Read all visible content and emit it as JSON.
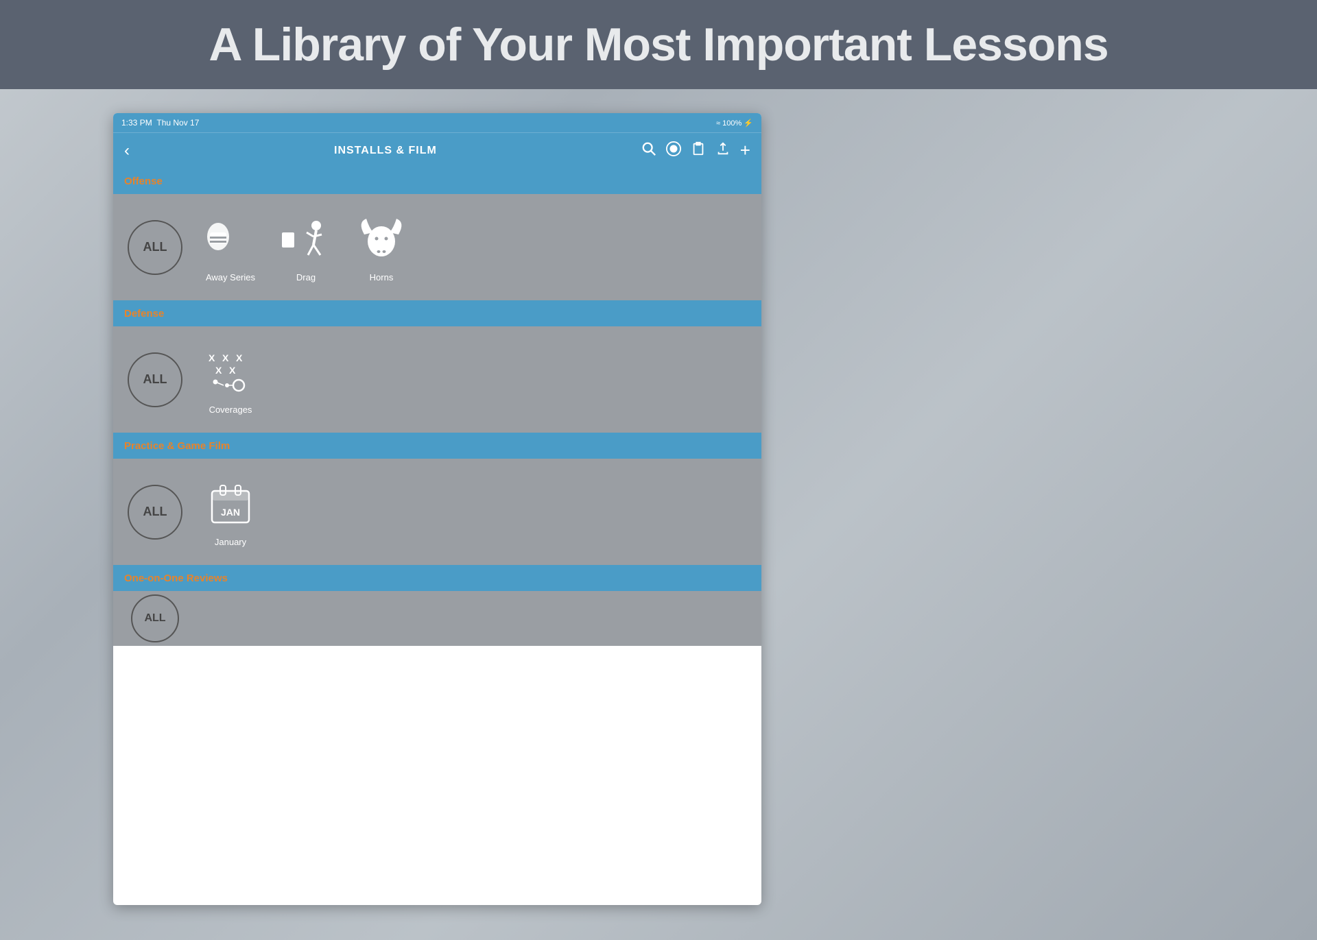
{
  "header": {
    "title": "A Library of Your Most Important Lessons",
    "background_color": "#5a6270"
  },
  "status_bar": {
    "time": "1:33 PM",
    "date": "Thu Nov 17",
    "battery": "100%",
    "signal": "wifi"
  },
  "nav_bar": {
    "back_label": "‹",
    "title": "INSTALLS & FILM",
    "icons": [
      "search",
      "record",
      "clipboard",
      "share",
      "plus"
    ]
  },
  "sections": [
    {
      "id": "offense",
      "title": "Offense",
      "title_color": "orange",
      "items": [
        {
          "id": "all-offense",
          "type": "circle",
          "label": "ALL"
        },
        {
          "id": "away-series",
          "type": "icon",
          "label": "Away Series",
          "icon": "away-series"
        },
        {
          "id": "drag",
          "type": "icon",
          "label": "Drag",
          "icon": "drag"
        },
        {
          "id": "horns",
          "type": "icon",
          "label": "Horns",
          "icon": "horns"
        }
      ]
    },
    {
      "id": "defense",
      "title": "Defense",
      "title_color": "orange",
      "items": [
        {
          "id": "all-defense",
          "type": "circle",
          "label": "ALL"
        },
        {
          "id": "coverages",
          "type": "icon",
          "label": "Coverages",
          "icon": "coverages"
        }
      ]
    },
    {
      "id": "practice-game-film",
      "title": "Practice & Game Film",
      "title_color": "orange",
      "items": [
        {
          "id": "all-film",
          "type": "circle",
          "label": "ALL"
        },
        {
          "id": "january",
          "type": "icon",
          "label": "January",
          "icon": "calendar"
        }
      ]
    },
    {
      "id": "one-on-one-reviews",
      "title": "One-on-One Reviews",
      "title_color": "orange",
      "items": [
        {
          "id": "all-reviews",
          "type": "circle",
          "label": "ALL"
        }
      ]
    }
  ]
}
